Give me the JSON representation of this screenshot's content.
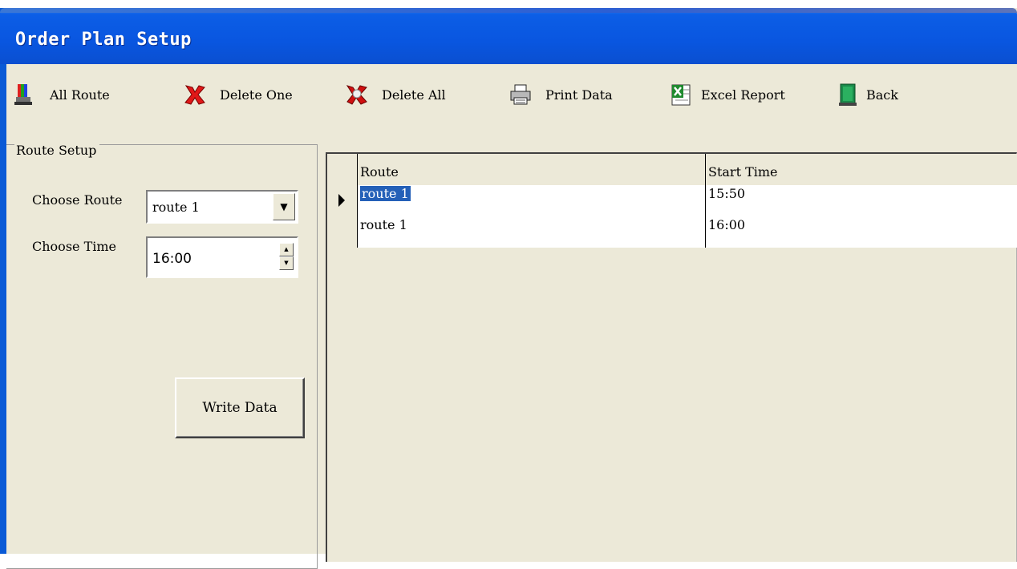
{
  "window": {
    "title": "Order Plan Setup"
  },
  "toolbar": {
    "items": [
      {
        "label": "All Route",
        "icon": "all-route-icon"
      },
      {
        "label": "Delete One",
        "icon": "delete-one-icon"
      },
      {
        "label": "Delete All",
        "icon": "delete-all-icon"
      },
      {
        "label": "Print Data",
        "icon": "printer-icon"
      },
      {
        "label": "Excel Report",
        "icon": "excel-icon"
      },
      {
        "label": "Back",
        "icon": "back-icon"
      }
    ]
  },
  "route_setup": {
    "legend": "Route Setup",
    "route_label": "Choose Route",
    "route_value": "route 1",
    "time_label": "Choose Time",
    "time_value": "16:00",
    "write_button": "Write Data"
  },
  "grid": {
    "columns": [
      "Route",
      "Start Time"
    ],
    "rows": [
      {
        "route": "route 1",
        "start_time": "15:50",
        "selected": true
      },
      {
        "route": "route 1",
        "start_time": "16:00",
        "selected": false
      }
    ]
  },
  "colors": {
    "title_bar": "#0956e0",
    "window_bg": "#ece9d8",
    "selection": "#2460b8"
  }
}
